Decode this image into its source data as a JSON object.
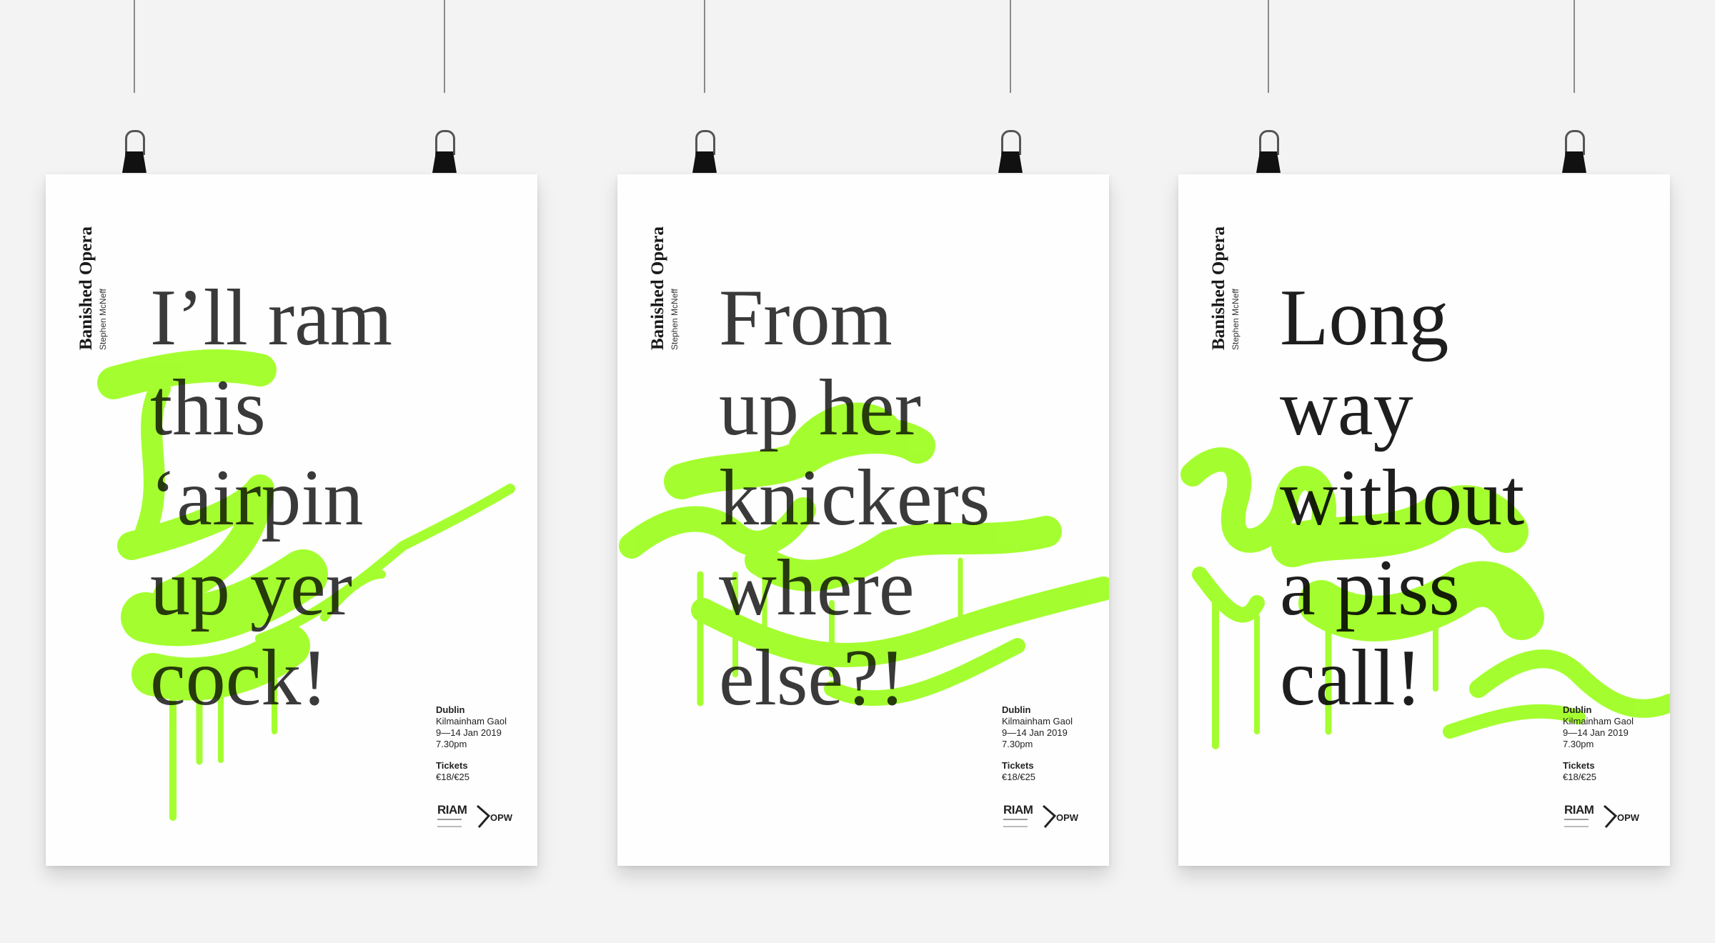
{
  "posters": [
    {
      "side_title": "Banished Opera",
      "side_sub": "Stephen McNeff",
      "headline": [
        "I’ll ram",
        "this",
        "‘airpin",
        "up yer",
        "cock!"
      ],
      "city": "Dublin",
      "venue": "Kilmainham Gaol",
      "dates": "9—14 Jan 2019",
      "time": "7.30pm",
      "tickets_label": "Tickets",
      "prices": "€18/€25",
      "logo_riam": "RIAM",
      "logo_opw": "OPW"
    },
    {
      "side_title": "Banished Opera",
      "side_sub": "Stephen McNeff",
      "headline": [
        "From",
        "up her",
        "knickers",
        "where",
        "else?!"
      ],
      "city": "Dublin",
      "venue": "Kilmainham Gaol",
      "dates": "9—14 Jan 2019",
      "time": "7.30pm",
      "tickets_label": "Tickets",
      "prices": "€18/€25",
      "logo_riam": "RIAM",
      "logo_opw": "OPW"
    },
    {
      "side_title": "Banished Opera",
      "side_sub": "Stephen McNeff",
      "headline": [
        "Long",
        "way",
        "without",
        "a piss",
        "call!"
      ],
      "city": "Dublin",
      "venue": "Kilmainham Gaol",
      "dates": "9—14 Jan 2019",
      "time": "7.30pm",
      "tickets_label": "Tickets",
      "prices": "€18/€25",
      "logo_riam": "RIAM",
      "logo_opw": "OPW"
    }
  ],
  "colors": {
    "spray": "#9dff1e",
    "text": "#3a3a3a",
    "background": "#f3f3f3",
    "clip": "#111111"
  }
}
